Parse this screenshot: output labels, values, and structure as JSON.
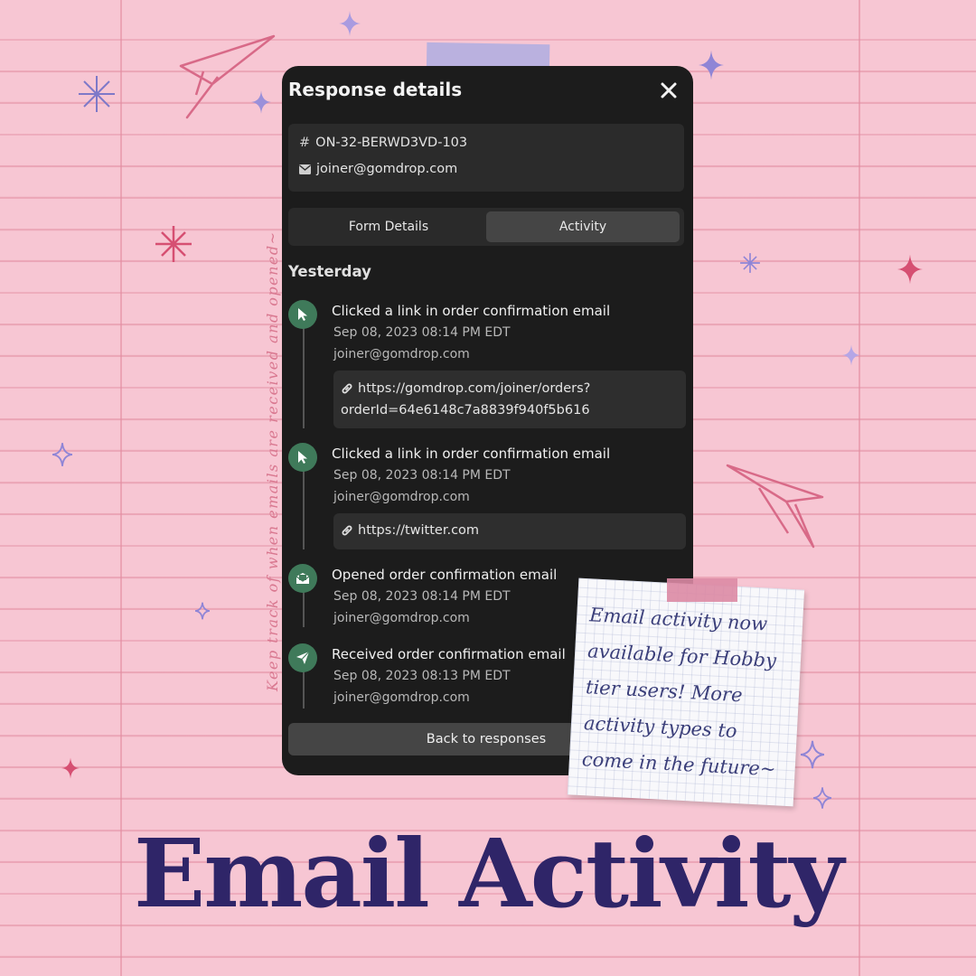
{
  "panel": {
    "title": "Response details",
    "order_id": "ON-32-BERWD3VD-103",
    "email": "joiner@gomdrop.com",
    "tabs": [
      {
        "label": "Form Details",
        "active": false
      },
      {
        "label": "Activity",
        "active": true
      }
    ],
    "section_label": "Yesterday",
    "activities": [
      {
        "icon": "cursor-icon",
        "title": "Clicked a link in order confirmation email",
        "time": "Sep 08, 2023 08:14 PM EDT",
        "email": "joiner@gomdrop.com",
        "link_line1": "https://gomdrop.com/joiner/orders?",
        "link_line2": "orderId=64e6148c7a8839f940f5b616"
      },
      {
        "icon": "cursor-icon",
        "title": "Clicked a link in order confirmation email",
        "time": "Sep 08, 2023 08:14 PM EDT",
        "email": "joiner@gomdrop.com",
        "link_line1": "https://twitter.com"
      },
      {
        "icon": "opened-mail-icon",
        "title": "Opened order confirmation email",
        "time": "Sep 08, 2023 08:14 PM EDT",
        "email": "joiner@gomdrop.com"
      },
      {
        "icon": "paper-plane-icon",
        "title": "Received order confirmation email",
        "time": "Sep 08, 2023 08:13 PM EDT",
        "email": "joiner@gomdrop.com"
      }
    ],
    "back_button": "Back to responses"
  },
  "note": {
    "line1": "Email activity now",
    "line2": "available for Hobby",
    "line3": "tier users! More",
    "line4": "activity types to",
    "line5": "come in the future~"
  },
  "vertical_caption": "Keep track of when emails are received and opened~",
  "headline": "Email Activity",
  "colors": {
    "background": "#f7c6d3",
    "panel": "#1c1c1c",
    "accent_green": "#3f7a5a",
    "headline": "#2f2568"
  }
}
